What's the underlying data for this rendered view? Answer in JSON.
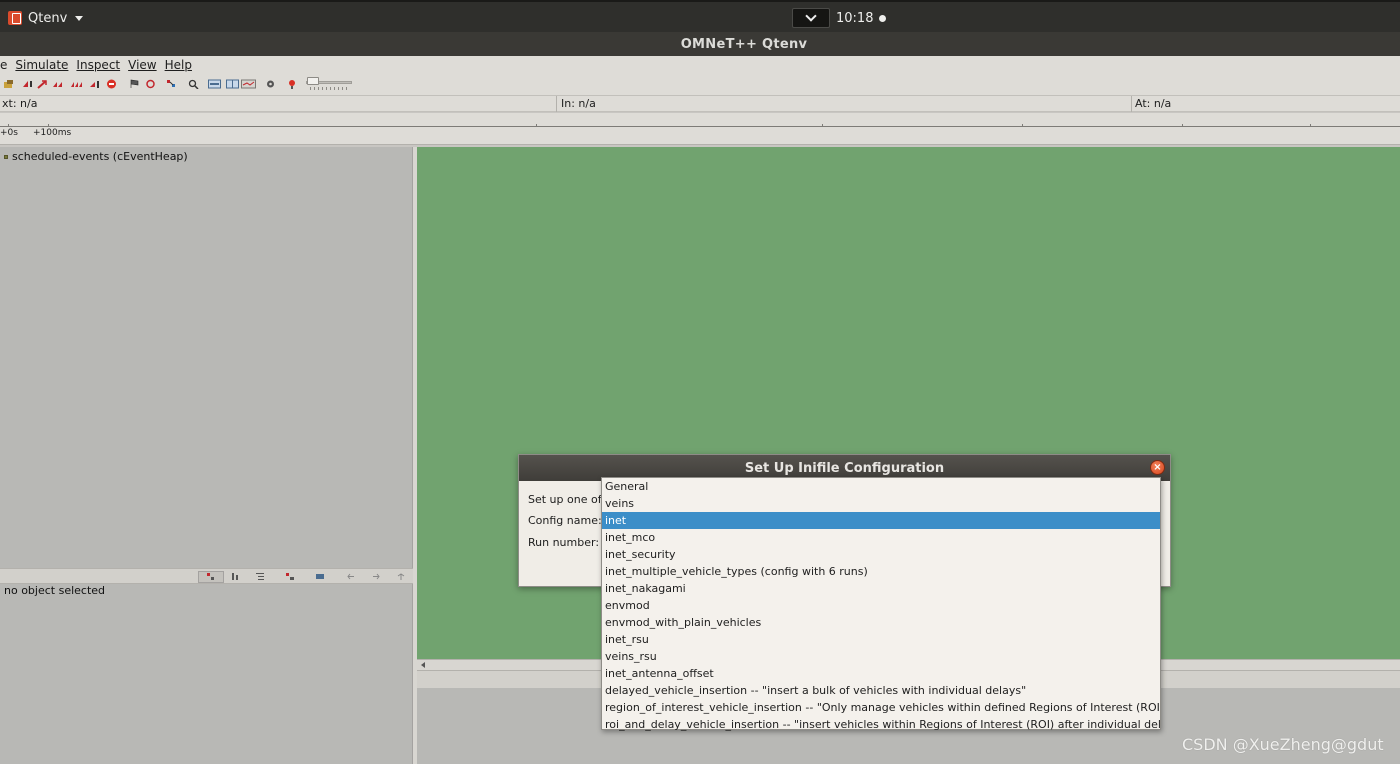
{
  "top_panel": {
    "app_name": "Qtenv",
    "clock": "10:18"
  },
  "window": {
    "title": "OMNeT++ Qtenv"
  },
  "menubar": {
    "items": [
      "e",
      "Simulate",
      "Inspect",
      "View",
      "Help"
    ]
  },
  "status_bar": {
    "next": "xt: n/a",
    "in": "In: n/a",
    "at": "At: n/a"
  },
  "timeline": {
    "labels": [
      "+0s",
      "+100ms"
    ]
  },
  "object_tree": {
    "root_label": "scheduled-events (cEventHeap)"
  },
  "inspector": {
    "empty_text": "no object selected"
  },
  "dialog": {
    "title": "Set Up Inifile Configuration",
    "intro": "Set up one of t",
    "config_label": "Config name:",
    "run_label": "Run number:",
    "options": [
      "General",
      "veins",
      "inet",
      "inet_mco",
      "inet_security",
      "inet_multiple_vehicle_types (config with 6 runs)",
      "inet_nakagami",
      "envmod",
      "envmod_with_plain_vehicles",
      "inet_rsu",
      "veins_rsu",
      "inet_antenna_offset",
      "delayed_vehicle_insertion -- \"insert a bulk of vehicles with individual delays\"",
      "region_of_interest_vehicle_insertion -- \"Only manage vehicles within defined Regions of Interest (ROI)\"",
      "roi_and_delay_vehicle_insertion --  \"insert vehicles within Regions of Interest (ROI) after individual delays\""
    ],
    "selected_option": "inet"
  },
  "watermark": "CSDN @XueZheng@gdut",
  "colors": {
    "canvas": "#71a36f",
    "selection": "#3c8ec8",
    "close_button": "#e05a2e"
  }
}
